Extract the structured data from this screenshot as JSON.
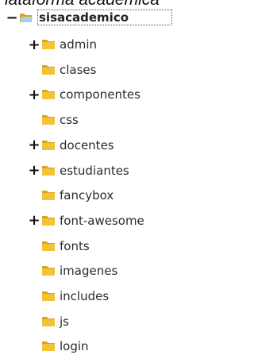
{
  "header": {
    "title": "lataforma académica"
  },
  "tree": {
    "root": {
      "label": "sisacademico",
      "toggle": "−",
      "icon": "folder-open-icon"
    },
    "children": [
      {
        "label": "admin",
        "toggle": "+",
        "icon": "folder-icon"
      },
      {
        "label": "clases",
        "toggle": "",
        "icon": "folder-icon"
      },
      {
        "label": "componentes",
        "toggle": "+",
        "icon": "folder-icon"
      },
      {
        "label": "css",
        "toggle": "",
        "icon": "folder-icon"
      },
      {
        "label": "docentes",
        "toggle": "+",
        "icon": "folder-icon"
      },
      {
        "label": "estudiantes",
        "toggle": "+",
        "icon": "folder-icon"
      },
      {
        "label": "fancybox",
        "toggle": "",
        "icon": "folder-icon"
      },
      {
        "label": "font-awesome",
        "toggle": "+",
        "icon": "folder-icon"
      },
      {
        "label": "fonts",
        "toggle": "",
        "icon": "folder-icon"
      },
      {
        "label": "imagenes",
        "toggle": "",
        "icon": "folder-icon"
      },
      {
        "label": "includes",
        "toggle": "",
        "icon": "folder-icon"
      },
      {
        "label": "js",
        "toggle": "",
        "icon": "folder-icon"
      },
      {
        "label": "login",
        "toggle": "",
        "icon": "folder-icon"
      }
    ]
  },
  "colors": {
    "folder": "#f2c237",
    "folder_dark": "#d9a520",
    "root_folder": "#9fd1e8"
  }
}
